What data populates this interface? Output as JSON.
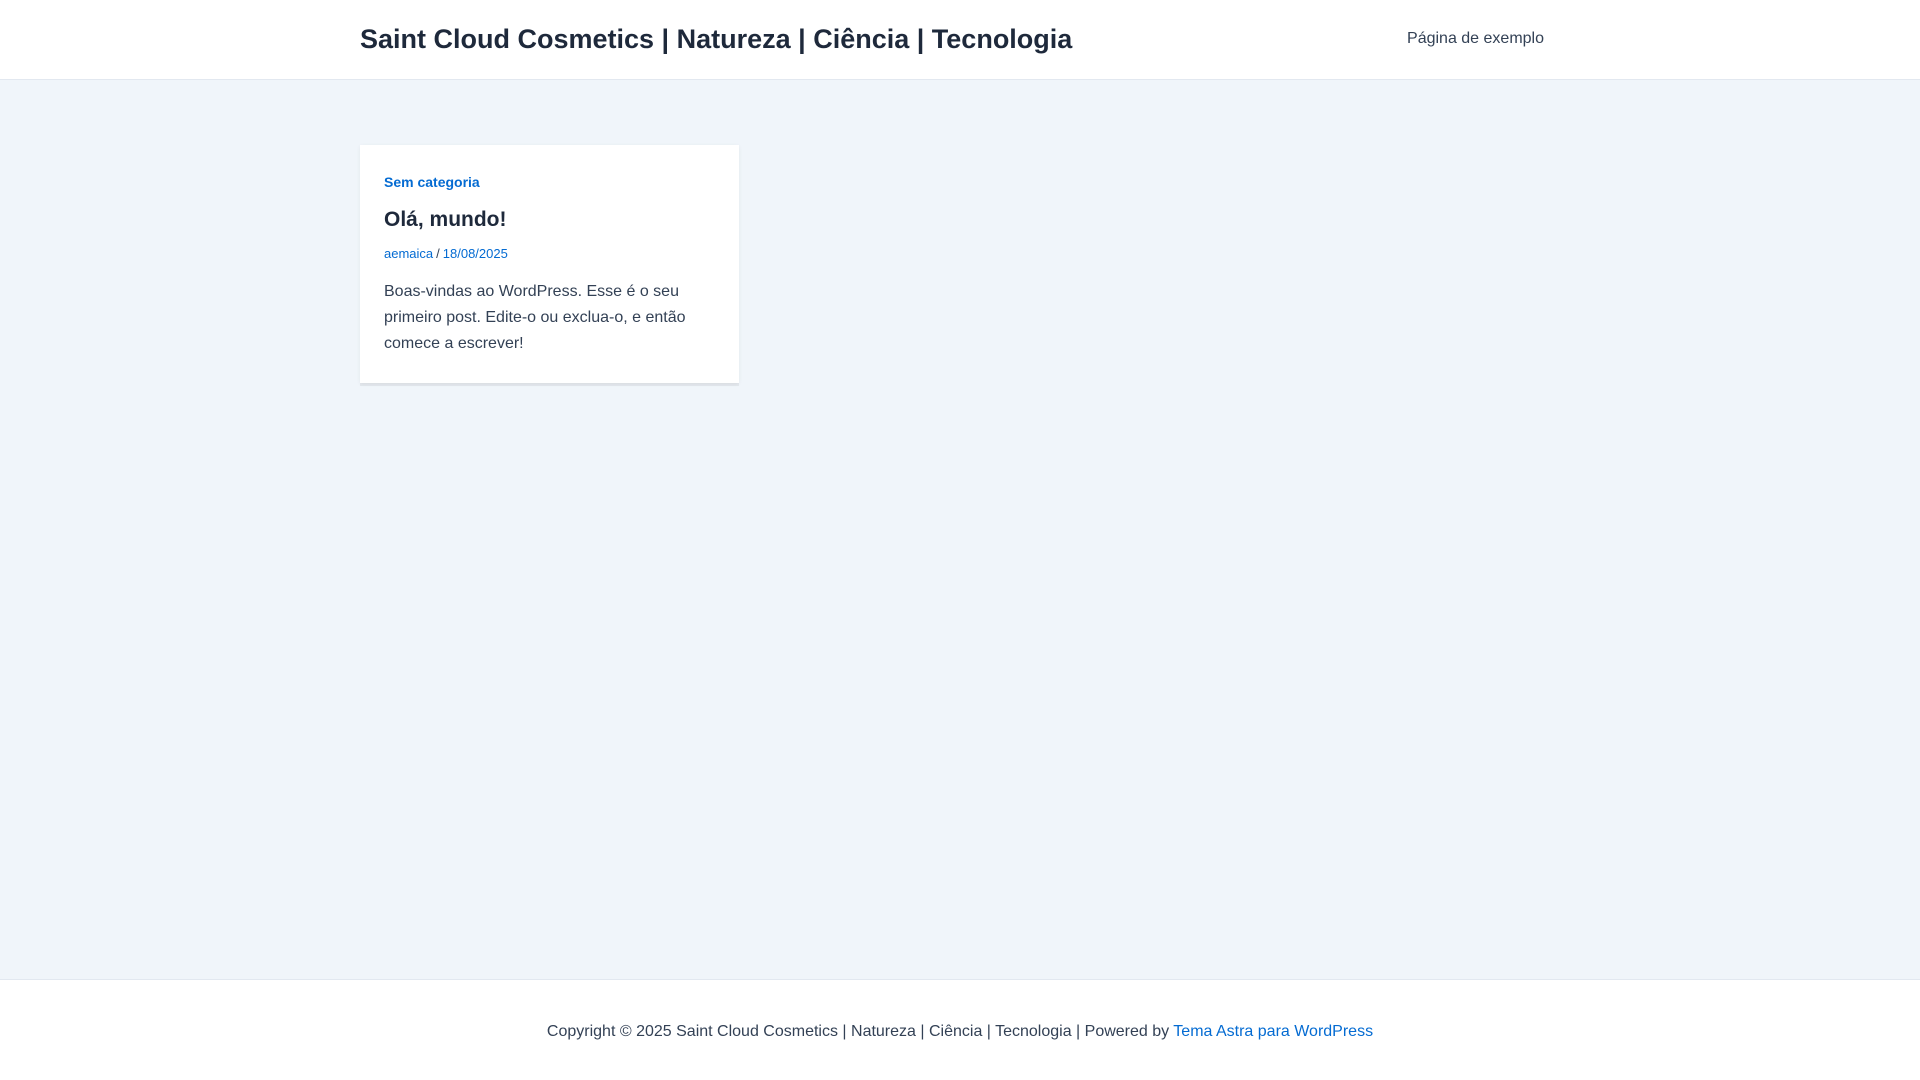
{
  "header": {
    "site_title": "Saint Cloud Cosmetics | Natureza | Ciência | Tecnologia",
    "nav": [
      {
        "label": "Página de exemplo"
      }
    ]
  },
  "main": {
    "posts": [
      {
        "category": "Sem categoria",
        "title": "Olá, mundo!",
        "author": "aemaica",
        "meta_separator": "/",
        "date": "18/08/2025",
        "excerpt": "Boas-vindas ao WordPress. Esse é o seu primeiro post. Edite-o ou exclua-o, e então comece a escrever!"
      }
    ]
  },
  "footer": {
    "copyright": "Copyright © 2025 Saint Cloud Cosmetics | Natureza | Ciência | Tecnologia | Powered by ",
    "theme_link": "Tema Astra para WordPress"
  },
  "colors": {
    "background": "#f0f5fa",
    "accent": "#046bd2",
    "text": "#334155",
    "heading": "#1e293b"
  }
}
